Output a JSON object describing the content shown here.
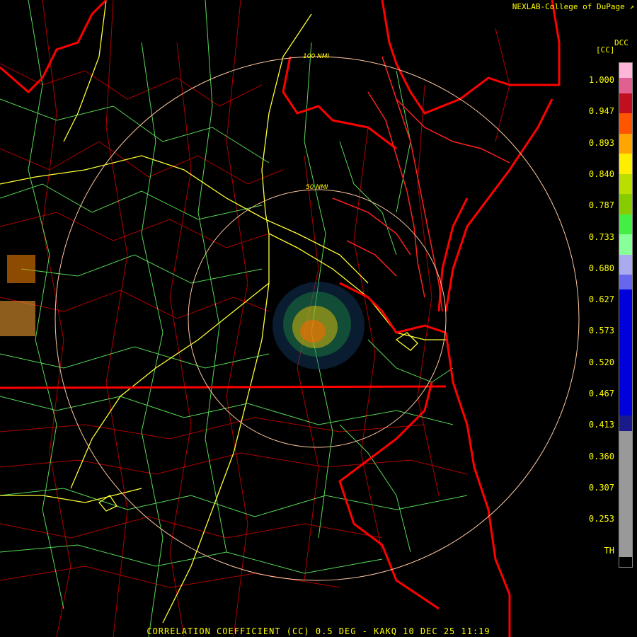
{
  "credit": "NEXLAB-College of DuPage",
  "legend": {
    "product": "DCC",
    "unit": "[CC]",
    "labels": [
      "1.000",
      "0.947",
      "0.893",
      "0.840",
      "0.787",
      "0.733",
      "0.680",
      "0.627",
      "0.573",
      "0.520",
      "0.467",
      "0.413",
      "0.360",
      "0.307",
      "0.253",
      "TH"
    ]
  },
  "rings": {
    "inner_label": "50 NMI",
    "outer_label": "100 NMI"
  },
  "footer": "CORRELATION COEFFICIENT (CC) 0.5 DEG - KAKQ 10 DEC 25 11:19",
  "colors": {
    "state_border": "#ff0000",
    "county_border": "#b00000",
    "roads": "#66ff66",
    "interstates": "#ffff33",
    "range_ring": "#ffc8a0",
    "text": "#ffff00"
  }
}
